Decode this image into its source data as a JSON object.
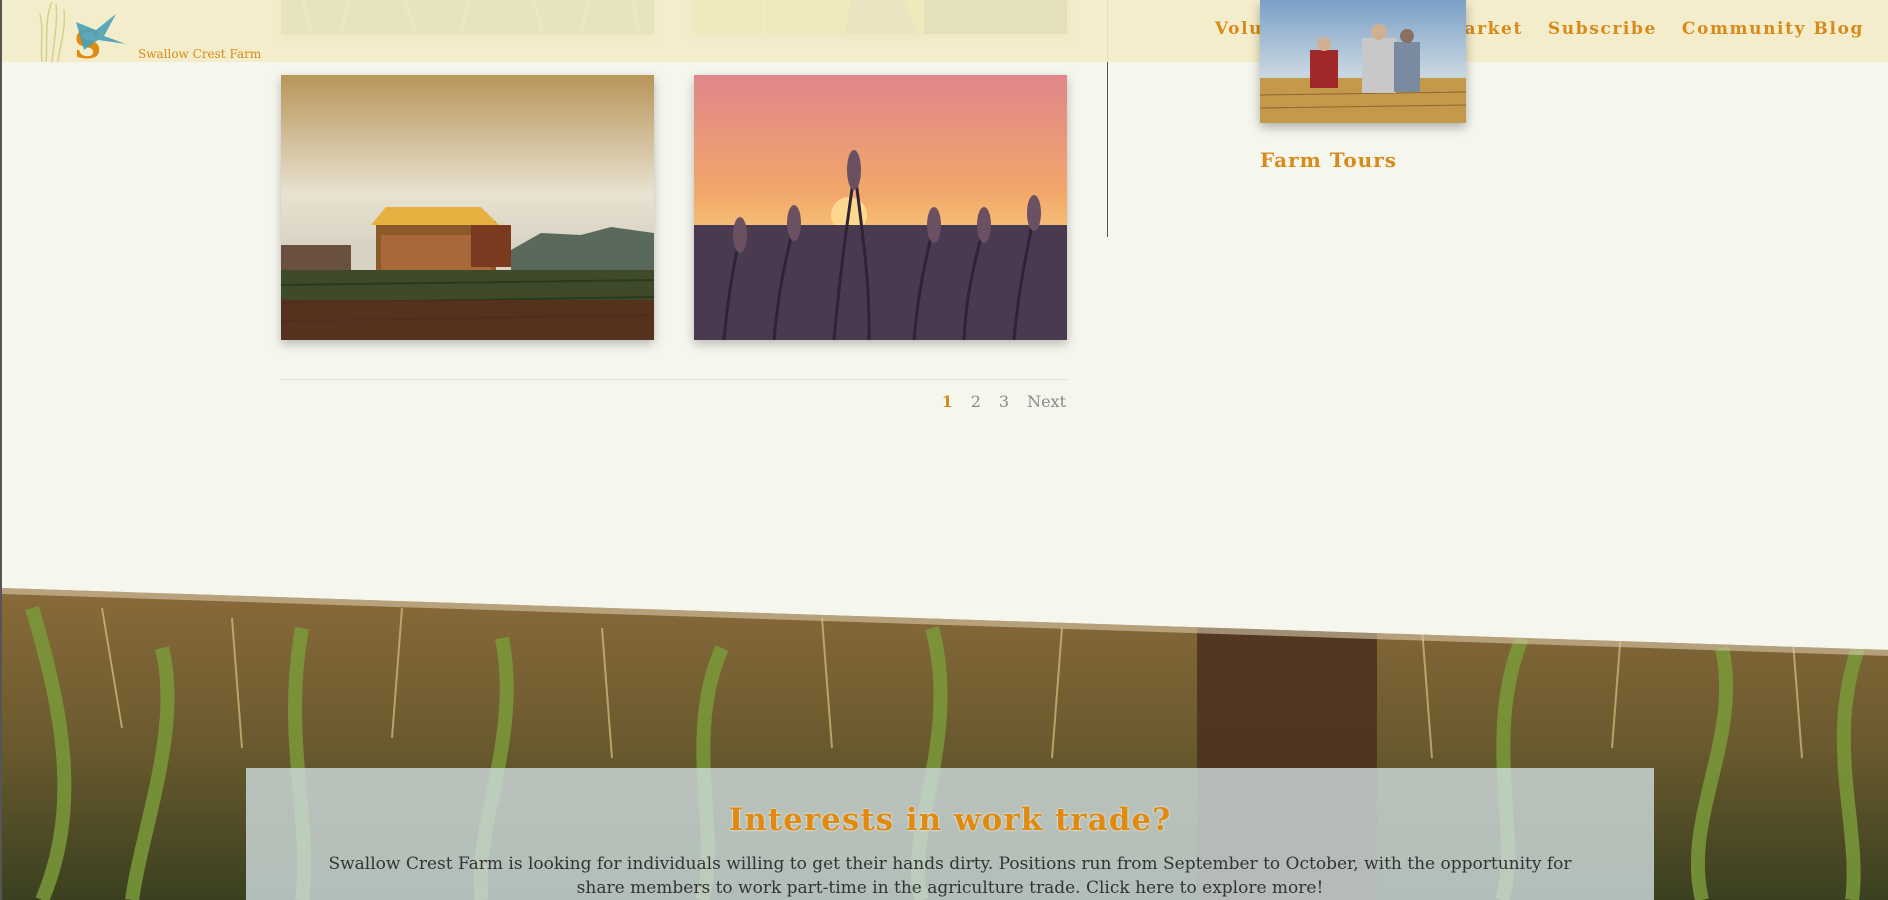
{
  "header": {
    "logo_text": "Swallow Crest Farm",
    "nav": [
      "Volunteer",
      "Farmers Market",
      "Subscribe",
      "Community Blog"
    ]
  },
  "sidebar": {
    "card_title": "Farm Tours"
  },
  "pagination": {
    "pages": [
      "1",
      "2",
      "3"
    ],
    "next_label": "Next",
    "current": "1"
  },
  "cta": {
    "title": "Interests in work trade?",
    "body": "Swallow Crest Farm is looking for individuals willing to get their hands dirty. Positions run from September to October, with the opportunity for share members to work part-time in the agriculture trade. Click here to explore more!"
  },
  "images": [
    {
      "name": "cornfield-thumbnail"
    },
    {
      "name": "farm-road-thumbnail"
    },
    {
      "name": "barn-at-dawn-thumbnail"
    },
    {
      "name": "wheat-sunset-thumbnail"
    },
    {
      "name": "family-in-field-thumbnail"
    }
  ],
  "colors": {
    "accent": "#d88a1a",
    "background": "#f5f6ee",
    "header_bg": "#f2ecc8"
  }
}
